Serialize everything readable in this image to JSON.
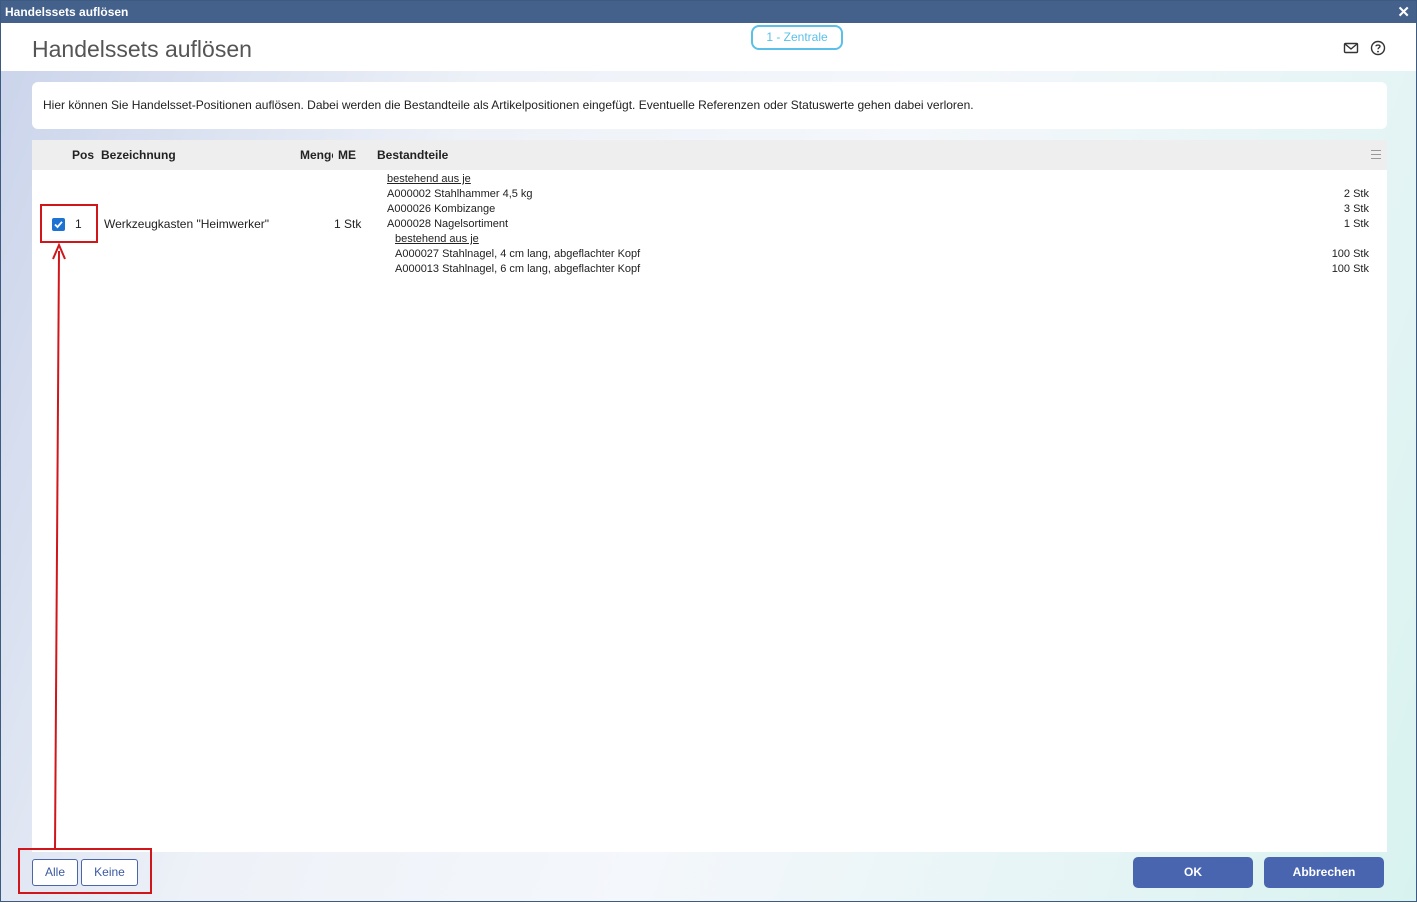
{
  "window": {
    "title": "Handelssets auflösen"
  },
  "header": {
    "title": "Handelssets auflösen",
    "branch": "1 - Zentrale"
  },
  "icons": {
    "mail": "mail-icon",
    "help": "help-icon",
    "close": "close-icon",
    "menu": "column-menu-icon"
  },
  "info_text": "Hier können Sie Handelsset-Positionen auflösen. Dabei werden die Bestandteile als Artikelpositionen eingefügt. Eventuelle Referenzen oder Statuswerte gehen dabei verloren.",
  "table": {
    "columns": [
      "Pos",
      "Bezeichnung",
      "Menge",
      "ME",
      "Bestandteile"
    ],
    "rows": [
      {
        "checked": true,
        "pos": "1",
        "bezeichnung": "Werkzeugkasten \"Heimwerker\"",
        "menge": "1",
        "me": "Stk",
        "bestandteile": {
          "header": "bestehend aus je",
          "items": [
            {
              "name": "A000002 Stahlhammer 4,5 kg",
              "qty": "2 Stk"
            },
            {
              "name": "A000026 Kombizange",
              "qty": "3 Stk"
            },
            {
              "name": "A000028 Nagelsortiment",
              "qty": "1 Stk"
            }
          ],
          "sub_header": "bestehend aus je",
          "sub_items": [
            {
              "name": "A000027 Stahlnagel, 4 cm lang, abgeflachter Kopf",
              "qty": "100 Stk"
            },
            {
              "name": "A000013 Stahlnagel, 6 cm lang, abgeflachter Kopf",
              "qty": "100 Stk"
            }
          ]
        }
      }
    ]
  },
  "footer": {
    "all": "Alle",
    "none": "Keine",
    "ok": "OK",
    "cancel": "Abbrechen"
  },
  "colors": {
    "titlebar": "#44618c",
    "accent": "#4a65b0",
    "highlight": "#d0161b",
    "branch": "#5bc0e8"
  }
}
